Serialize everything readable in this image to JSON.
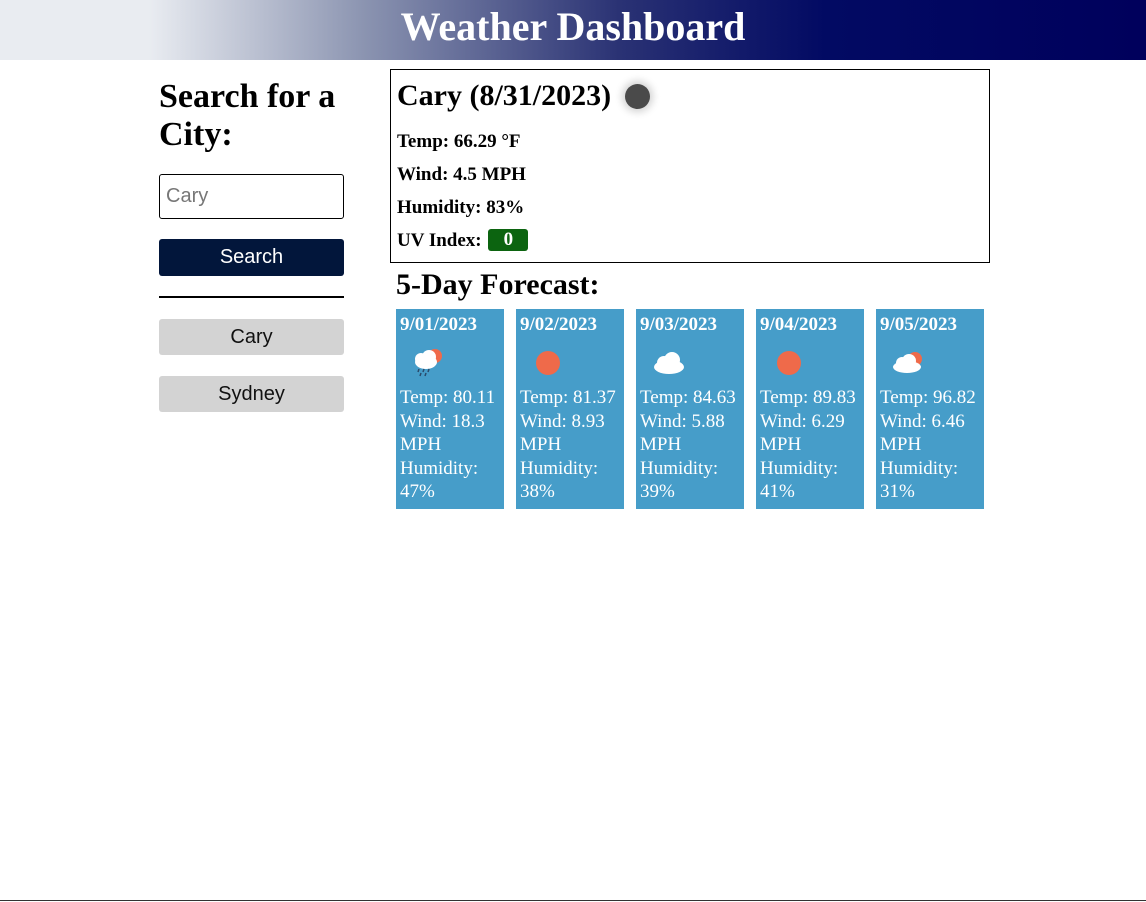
{
  "header": {
    "title": "Weather Dashboard"
  },
  "sidebar": {
    "heading": "Search for a City:",
    "search_placeholder": "Cary",
    "search_button": "Search",
    "history": [
      "Cary",
      "Sydney"
    ]
  },
  "current": {
    "title": "Cary (8/31/2023)",
    "icon": "moon-icon",
    "temp": "Temp: 66.29 °F",
    "wind": "Wind: 4.5 MPH",
    "humidity": "Humidity: 83%",
    "uv_label": "UV Index:",
    "uv_value": "0",
    "uv_color": "#0c6410"
  },
  "forecast": {
    "title": "5-Day Forecast:",
    "days": [
      {
        "date": "9/01/2023",
        "icon": "rain-cloud-icon",
        "temp": "Temp: 80.11",
        "wind1": "Wind: 18.3",
        "wind2": "MPH",
        "hum1": "Humidity:",
        "hum2": "47%"
      },
      {
        "date": "9/02/2023",
        "icon": "sun-icon",
        "temp": "Temp: 81.37",
        "wind1": "Wind: 8.93",
        "wind2": "MPH",
        "hum1": "Humidity:",
        "hum2": "38%"
      },
      {
        "date": "9/03/2023",
        "icon": "cloud-icon",
        "temp": "Temp: 84.63",
        "wind1": "Wind: 5.88",
        "wind2": "MPH",
        "hum1": "Humidity:",
        "hum2": "39%"
      },
      {
        "date": "9/04/2023",
        "icon": "sun-icon",
        "temp": "Temp: 89.83",
        "wind1": "Wind: 6.29",
        "wind2": "MPH",
        "hum1": "Humidity:",
        "hum2": "41%"
      },
      {
        "date": "9/05/2023",
        "icon": "partly-cloudy-icon",
        "temp": "Temp: 96.82",
        "wind1": "Wind: 6.46",
        "wind2": "MPH",
        "hum1": "Humidity:",
        "hum2": "31%"
      }
    ]
  },
  "colors": {
    "card_bg": "#469dc9",
    "search_button_bg": "#02163b",
    "history_bg": "#d3d3d3",
    "sun": "#ef6a4a"
  }
}
